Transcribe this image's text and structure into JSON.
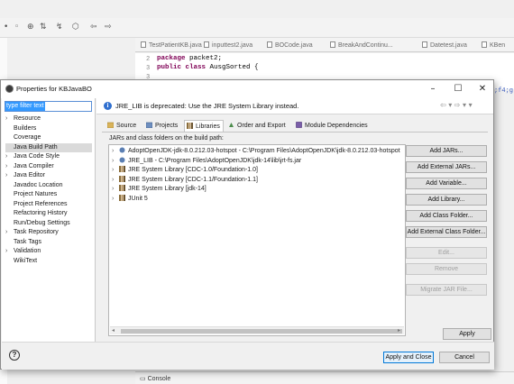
{
  "background": {
    "editor_tabs": [
      "TestPatientKB.java",
      "inputtest2.java",
      "BOCode.java",
      "BreakAndContinu...",
      "Datetest.java",
      "KBen"
    ],
    "code_lines": [
      {
        "num": "2",
        "text": "package packet2;"
      },
      {
        "num": "3",
        "text": "public class AusgSorted {"
      },
      {
        "num": "3",
        "text": ""
      }
    ],
    "right_fragment": ";f4;g",
    "console_label": "Console"
  },
  "dialog": {
    "title": "Properties for KBJavaBO",
    "filter": {
      "placeholder": "type filter text",
      "value": "type filter text"
    },
    "nav_items": [
      {
        "label": "Resource",
        "expandable": true
      },
      {
        "label": "Builders",
        "expandable": false
      },
      {
        "label": "Coverage",
        "expandable": false
      },
      {
        "label": "Java Build Path",
        "expandable": false,
        "selected": true
      },
      {
        "label": "Java Code Style",
        "expandable": true
      },
      {
        "label": "Java Compiler",
        "expandable": true
      },
      {
        "label": "Java Editor",
        "expandable": true
      },
      {
        "label": "Javadoc Location",
        "expandable": false
      },
      {
        "label": "Project Natures",
        "expandable": false
      },
      {
        "label": "Project References",
        "expandable": false
      },
      {
        "label": "Refactoring History",
        "expandable": false
      },
      {
        "label": "Run/Debug Settings",
        "expandable": false
      },
      {
        "label": "Task Repository",
        "expandable": true
      },
      {
        "label": "Task Tags",
        "expandable": false
      },
      {
        "label": "Validation",
        "expandable": true
      },
      {
        "label": "WikiText",
        "expandable": false
      }
    ],
    "banner": "JRE_LIB is deprecated: Use the JRE System Library instead.",
    "tabs": [
      {
        "label": "Source",
        "icon": "source-folder-icon"
      },
      {
        "label": "Projects",
        "icon": "projects-icon"
      },
      {
        "label": "Libraries",
        "icon": "libraries-icon",
        "active": true
      },
      {
        "label": "Order and Export",
        "icon": "order-export-icon"
      },
      {
        "label": "Module Dependencies",
        "icon": "module-icon"
      }
    ],
    "jars_label": "JARs and class folders on the build path:",
    "libraries": [
      {
        "label": "AdoptOpenJDK-jdk-8.0.212.03-hotspot - C:\\Program Files\\AdoptOpenJDK\\jdk-8.0.212.03-hotspot",
        "icon": "jar-icon"
      },
      {
        "label": "JRE_LIB - C:\\Program Files\\AdoptOpenJDK\\jdk-14\\lib\\jrt-fs.jar",
        "icon": "jar-icon"
      },
      {
        "label": "JRE System Library [CDC-1.0/Foundation-1.0]",
        "icon": "library-icon"
      },
      {
        "label": "JRE System Library [CDC-1.1/Foundation-1.1]",
        "icon": "library-icon"
      },
      {
        "label": "JRE System Library [jdk-14]",
        "icon": "library-icon"
      },
      {
        "label": "JUnit 5",
        "icon": "library-icon"
      }
    ],
    "buttons": [
      {
        "label": "Add JARs...",
        "enabled": true
      },
      {
        "label": "Add External JARs...",
        "enabled": true
      },
      {
        "label": "Add Variable...",
        "enabled": true
      },
      {
        "label": "Add Library...",
        "enabled": true
      },
      {
        "label": "Add Class Folder...",
        "enabled": true
      },
      {
        "label": "Add External Class Folder...",
        "enabled": true
      },
      {
        "label": "Edit...",
        "enabled": false
      },
      {
        "label": "Remove",
        "enabled": false
      },
      {
        "label": "Migrate JAR File...",
        "enabled": false
      }
    ],
    "apply_label": "Apply",
    "apply_close_label": "Apply and Close",
    "cancel_label": "Cancel"
  },
  "colors": {
    "accent": "#0078d7",
    "selection": "#3399ff",
    "keyword": "#7f0055"
  }
}
